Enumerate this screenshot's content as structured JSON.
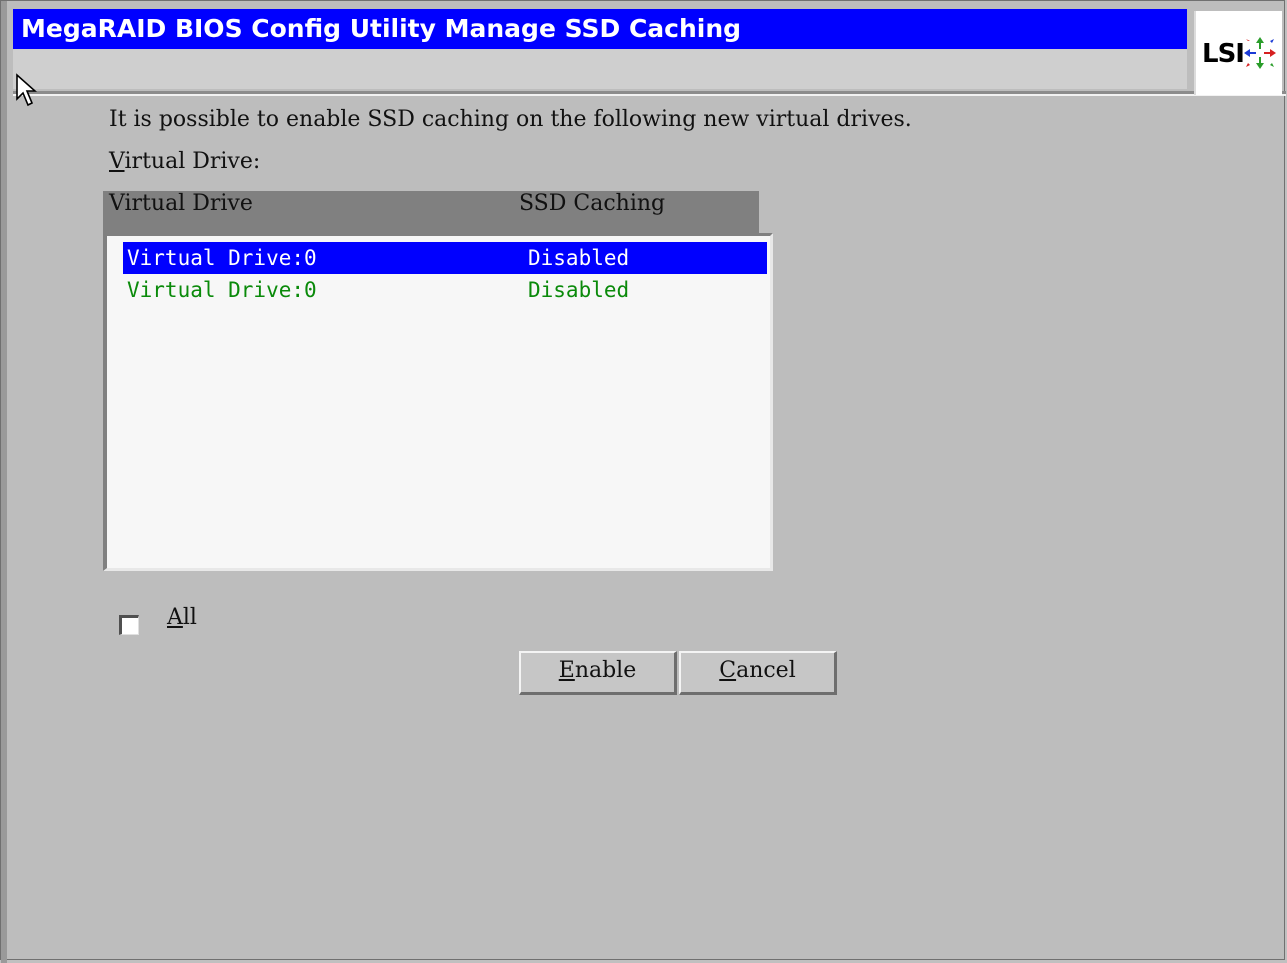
{
  "window": {
    "title": "MegaRAID BIOS Config Utility Manage SSD Caching",
    "logo_text": "LSI"
  },
  "main": {
    "intro_text": "It is possible to enable SSD caching on the following new virtual drives.",
    "list_label_first": "V",
    "list_label_rest": "irtual Drive:",
    "columns": [
      "Virtual Drive",
      "SSD Caching"
    ],
    "rows": [
      {
        "drive": "Virtual Drive:0",
        "caching": "Disabled",
        "selected": true
      },
      {
        "drive": "Virtual Drive:0",
        "caching": "Disabled",
        "selected": false
      }
    ],
    "all_checkbox": {
      "label_first": "A",
      "label_rest": "ll",
      "checked": false
    }
  },
  "buttons": {
    "enable_first": "E",
    "enable_rest": "nable",
    "cancel_first": "C",
    "cancel_rest": "ancel"
  },
  "colors": {
    "title_bar": "#0000ff",
    "selection": "#0000ff",
    "row_text": "#0a8a0a",
    "background": "#bdbdbd"
  }
}
